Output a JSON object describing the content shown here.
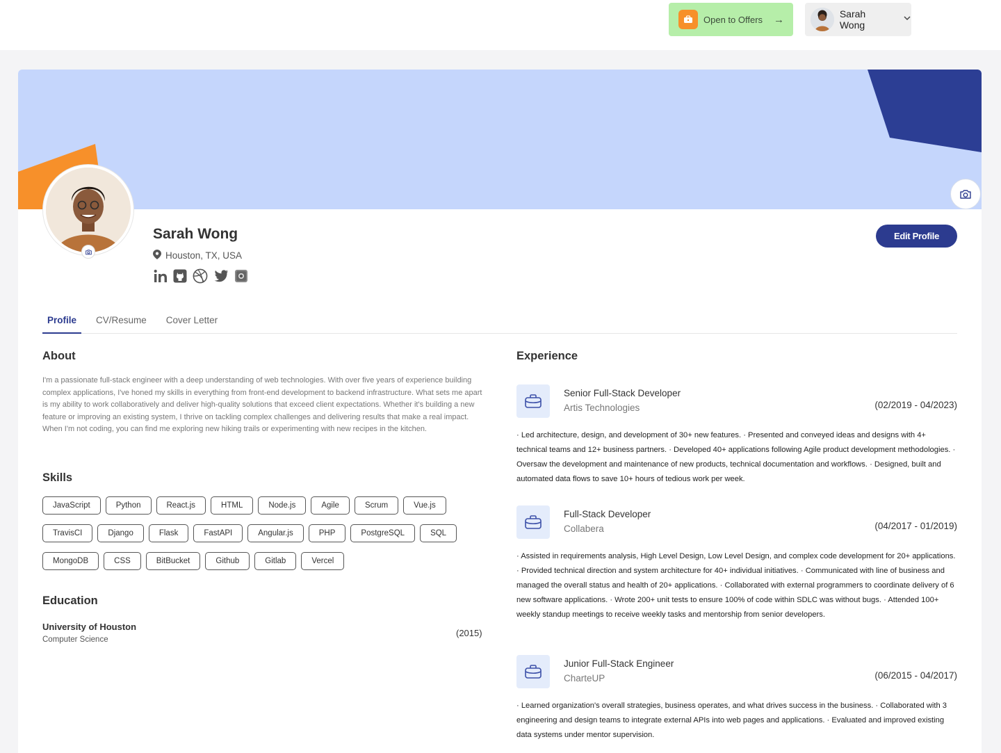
{
  "header": {
    "offers_label": "Open to Offers",
    "offers_arrow": "→",
    "user_name": "Sarah Wong"
  },
  "profile": {
    "name": "Sarah Wong",
    "location": "Houston, TX, USA",
    "edit_label": "Edit Profile",
    "social_icons": [
      "linkedin-icon",
      "github-icon",
      "dribbble-icon",
      "twitter-icon",
      "instagram-icon"
    ]
  },
  "tabs": [
    "Profile",
    "CV/Resume",
    "Cover Letter"
  ],
  "about": {
    "heading": "About",
    "text": "I'm a passionate full-stack engineer with a deep understanding of web technologies. With over five years of experience building complex applications, I've honed my skills in everything from front-end development to backend infrastructure. What sets me apart is my ability to work collaboratively and deliver high-quality solutions that exceed client expectations. Whether it's building a new feature or improving an existing system, I thrive on tackling complex challenges and delivering results that make a real impact. When I'm not coding, you can find me exploring new hiking trails or experimenting with new recipes in the kitchen."
  },
  "skills": {
    "heading": "Skills",
    "rows": [
      [
        "JavaScript",
        "Python",
        "React.js",
        "HTML",
        "Node.js",
        "Agile",
        "Scrum",
        "Vue.js"
      ],
      [
        "TravisCI",
        "Django",
        "Flask",
        "FastAPI",
        "Angular.js",
        "PHP",
        "PostgreSQL",
        "SQL"
      ],
      [
        "MongoDB",
        "CSS",
        "BitBucket",
        "Github",
        "Gitlab",
        "Vercel"
      ]
    ]
  },
  "education": {
    "heading": "Education",
    "school": "University of Houston",
    "field": "Computer Science",
    "year": "(2015)"
  },
  "experience": {
    "heading": "Experience",
    "items": [
      {
        "title": "Senior Full-Stack Developer",
        "company": "Artis Technologies",
        "dates": "(02/2019 - 04/2023)",
        "description": "· Led architecture, design, and development of 30+ new features. · Presented and conveyed ideas and designs with 4+ technical teams and 12+ business partners. · Developed 40+ applications following Agile product development methodologies. · Oversaw the development and maintenance of new products, technical documentation and workflows. · Designed, built and automated data flows to save 10+ hours of tedious work per week."
      },
      {
        "title": "Full-Stack Developer",
        "company": "Collabera",
        "dates": "(04/2017 - 01/2019)",
        "description": "· Assisted in requirements analysis, High Level Design, Low Level Design, and complex code development for 20+ applications. · Provided technical direction and system architecture for 40+ individual initiatives. · Communicated with line of business and managed the overall status and health of 20+ applications. · Collaborated with external programmers to coordinate delivery of 6 new software applications. · Wrote 200+ unit tests to ensure 100% of code within SDLC was without bugs. · Attended 100+ weekly standup meetings to receive weekly tasks and mentorship from senior developers."
      },
      {
        "title": "Junior Full-Stack Engineer",
        "company": "CharteUP",
        "dates": "(06/2015 - 04/2017)",
        "description": "· Learned organization's overall strategies, business operates, and what drives success in the business. · Collaborated with 3 engineering and design teams to integrate external APIs into web pages and applications. · Evaluated and improved existing data systems under mentor supervision."
      }
    ]
  },
  "colors": {
    "brand": "#2c3b8f",
    "banner": "#c5d6fc",
    "accent_orange": "#f7902a",
    "offers_bg": "#b6eea9"
  }
}
